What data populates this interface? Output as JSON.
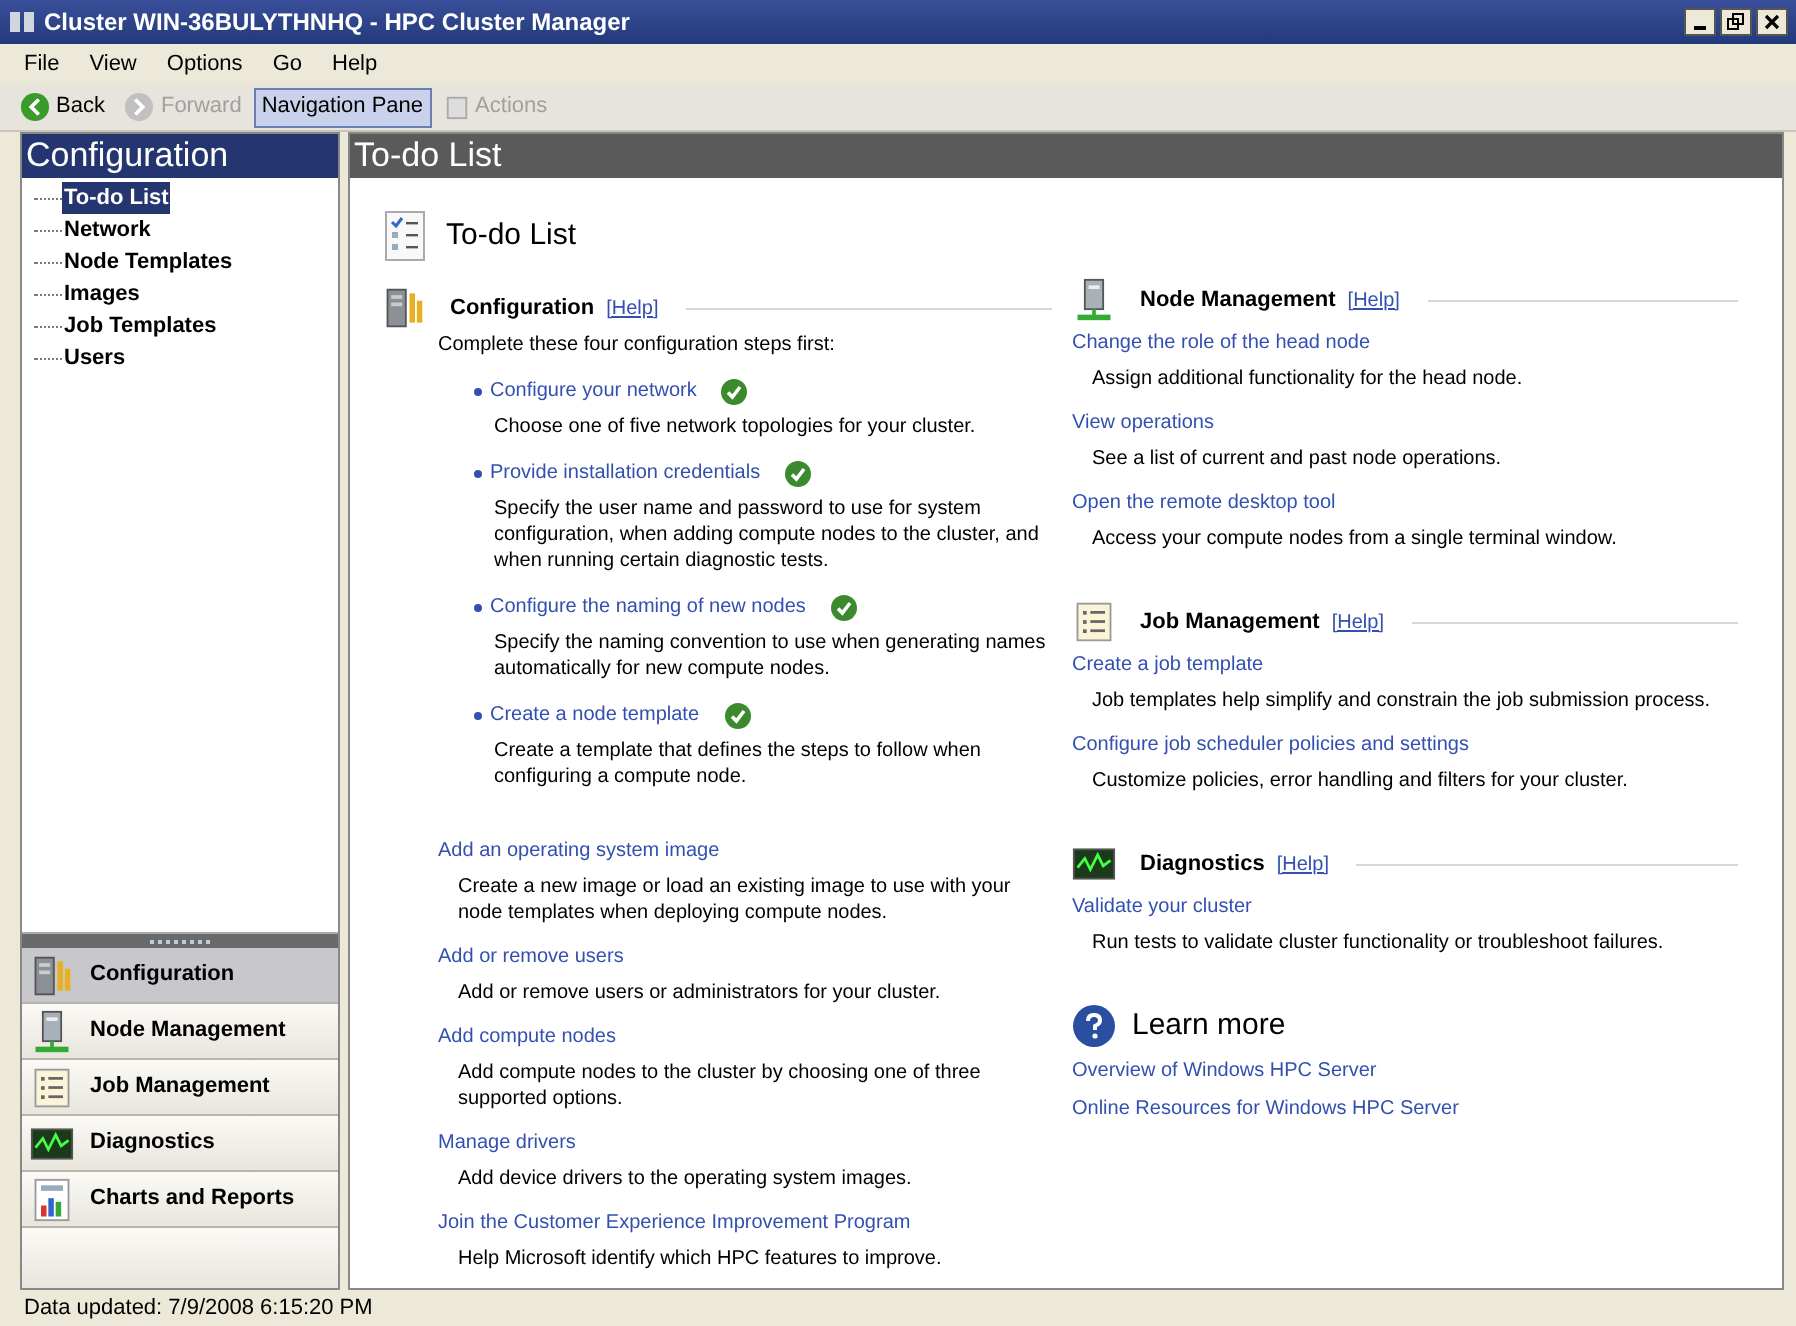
{
  "window": {
    "title": "Cluster WIN-36BULYTHNHQ - HPC Cluster Manager"
  },
  "menu": [
    "File",
    "View",
    "Options",
    "Go",
    "Help"
  ],
  "toolbar": [
    {
      "label": "Back",
      "disabled": false,
      "selected": false
    },
    {
      "label": "Forward",
      "disabled": true,
      "selected": false
    },
    {
      "label": "Navigation Pane",
      "disabled": false,
      "selected": true
    },
    {
      "label": "Actions",
      "disabled": true,
      "selected": false
    }
  ],
  "nav": {
    "header": "Configuration",
    "tree": [
      {
        "label": "To-do List",
        "selected": true
      },
      {
        "label": "Network",
        "selected": false
      },
      {
        "label": "Node Templates",
        "selected": false
      },
      {
        "label": "Images",
        "selected": false
      },
      {
        "label": "Job Templates",
        "selected": false
      },
      {
        "label": "Users",
        "selected": false
      }
    ],
    "sections": [
      {
        "label": "Configuration",
        "selected": true
      },
      {
        "label": "Node Management",
        "selected": false
      },
      {
        "label": "Job Management",
        "selected": false
      },
      {
        "label": "Diagnostics",
        "selected": false
      },
      {
        "label": "Charts and Reports",
        "selected": false
      }
    ]
  },
  "content": {
    "header": "To-do List",
    "page_title": "To-do List",
    "configuration": {
      "title": "Configuration",
      "help": "[Help]",
      "intro": "Complete these four configuration steps first:",
      "steps": [
        {
          "link": "Configure your network",
          "done": true,
          "description": "Choose one of five network topologies for your cluster."
        },
        {
          "link": "Provide installation credentials",
          "done": true,
          "description": "Specify the user name and password to use for system configuration, when adding compute nodes to the cluster, and when running certain diagnostic tests."
        },
        {
          "link": "Configure the naming of new nodes",
          "done": true,
          "description": "Specify the naming convention to use when generating names automatically for new compute nodes."
        },
        {
          "link": "Create a node template",
          "done": true,
          "description": "Create a template that defines the steps to follow when configuring a compute node."
        }
      ],
      "tasks": [
        {
          "link": "Add an operating system image",
          "description": "Create a new image or load an existing image to use with your node templates when deploying compute nodes."
        },
        {
          "link": "Add or remove users",
          "description": "Add or remove users or administrators for your cluster."
        },
        {
          "link": "Add compute nodes",
          "description": "Add compute nodes to the cluster by choosing one of three supported options."
        },
        {
          "link": "Manage drivers",
          "description": "Add device drivers to the operating system images."
        },
        {
          "link": "Join the Customer Experience Improvement Program",
          "description": "Help Microsoft identify which HPC features to improve."
        }
      ]
    },
    "sections": [
      {
        "title": "Node Management",
        "help": "[Help]",
        "tasks": [
          {
            "link": "Change the role of the head node",
            "description": "Assign additional functionality for the head node."
          },
          {
            "link": "View operations",
            "description": "See a list of current and past node operations."
          },
          {
            "link": "Open the remote desktop tool",
            "description": "Access your compute nodes from a single terminal window."
          }
        ]
      },
      {
        "title": "Job Management",
        "help": "[Help]",
        "tasks": [
          {
            "link": "Create a job template",
            "description": "Job templates help simplify and constrain the job submission process."
          },
          {
            "link": "Configure job scheduler policies and settings",
            "description": "Customize policies, error handling and filters for your cluster."
          }
        ]
      },
      {
        "title": "Diagnostics",
        "help": "[Help]",
        "tasks": [
          {
            "link": "Validate your cluster",
            "description": "Run tests to validate cluster functionality or troubleshoot failures."
          }
        ]
      }
    ],
    "learn_more": {
      "title": "Learn more",
      "links": [
        "Overview of Windows HPC Server",
        "Online Resources for Windows HPC Server"
      ]
    }
  },
  "status_bar": "Data updated: 7/9/2008 6:15:20 PM"
}
